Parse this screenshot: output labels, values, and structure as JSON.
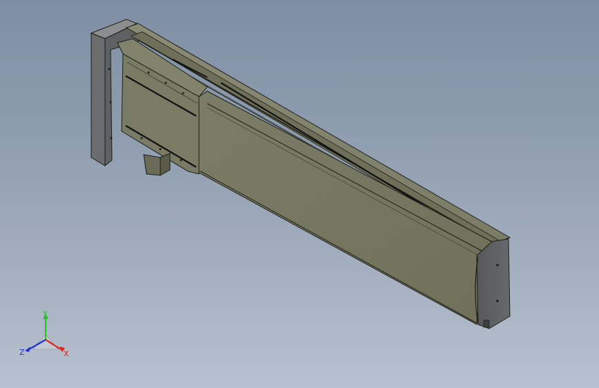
{
  "viewport": {
    "background_top": "#7f8ea3",
    "background_bottom": "#b8c1cf"
  },
  "model": {
    "body_color": "#76775f",
    "edge_color": "#1c1d16",
    "end_cap_color": "#5c5e60"
  },
  "triad": {
    "x_label": "X",
    "y_label": "Y",
    "z_label": "Z",
    "x_color": "#e0201c",
    "y_color": "#2bbf2b",
    "z_color": "#2030d8"
  }
}
